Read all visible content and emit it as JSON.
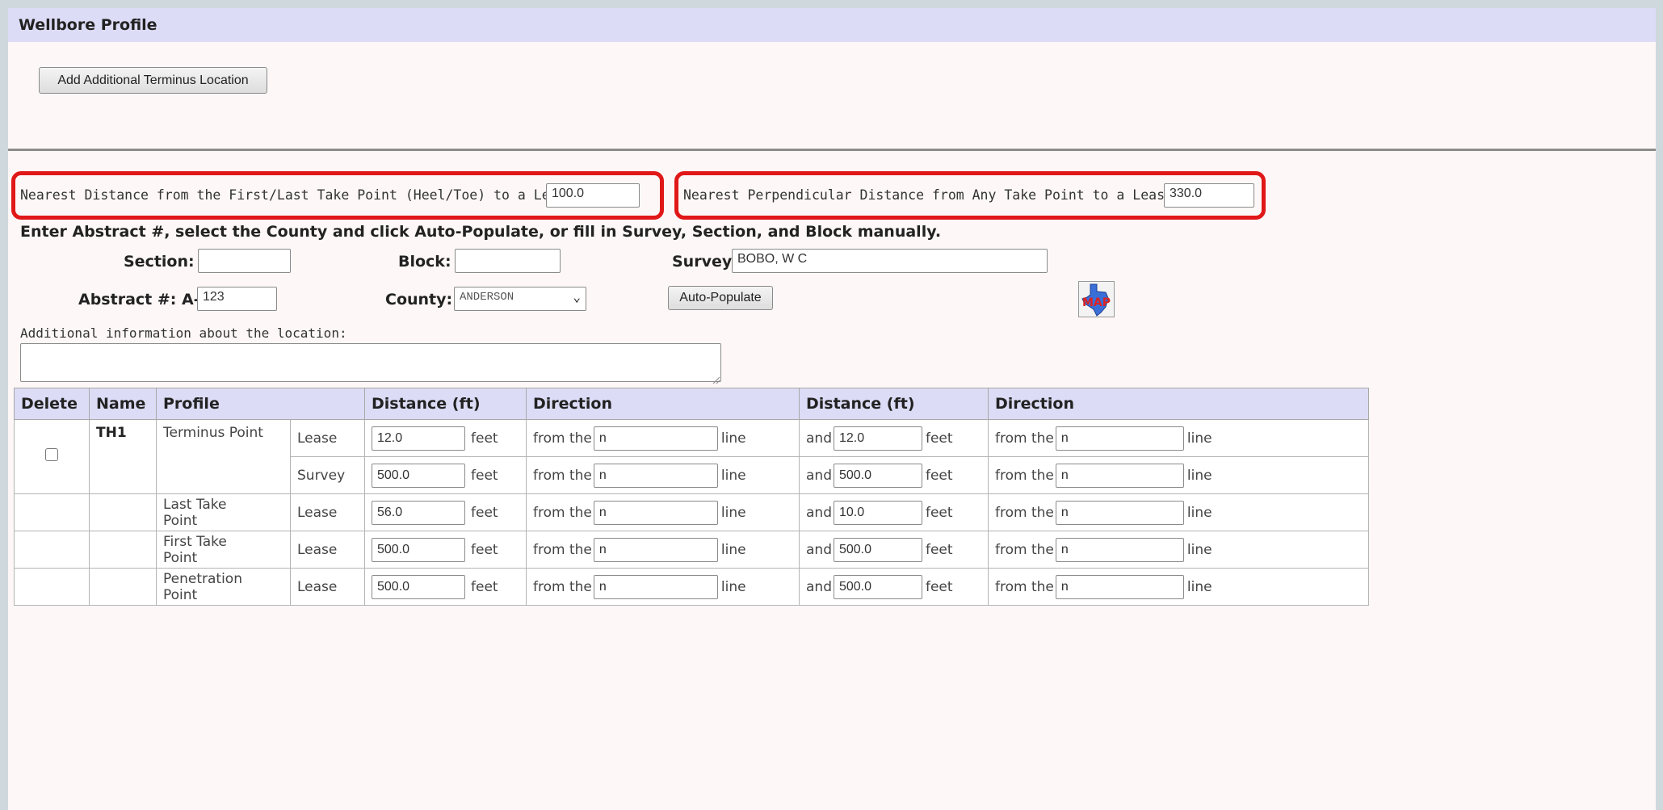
{
  "section_title": "Wellbore Profile",
  "add_terminus_button": "Add Additional Terminus Location",
  "nearest_first_last": {
    "label": "Nearest Distance from the First/Last Take Point (Heel/Toe) to a Lease Line:",
    "value": "100.0"
  },
  "nearest_perpendicular": {
    "label": "Nearest Perpendicular Distance from Any Take Point to a Lease Line:",
    "value": "330.0"
  },
  "instructions": "Enter Abstract #, select the County and click Auto-Populate, or fill in Survey, Section, and Block manually.",
  "section_field": {
    "label": "Section:",
    "value": ""
  },
  "block_field": {
    "label": "Block:",
    "value": ""
  },
  "survey_field": {
    "label": "Survey:",
    "value": "BOBO, W C"
  },
  "abstract_field": {
    "label": "Abstract #: A-",
    "value": "123"
  },
  "county_field": {
    "label": "County:",
    "value": "ANDERSON"
  },
  "auto_populate_button": "Auto-Populate",
  "map_icon": "MAP",
  "additional_info": {
    "label": "Additional information about the location:",
    "value": ""
  },
  "table": {
    "headers": [
      "Delete",
      "Name",
      "Profile",
      "Distance (ft)",
      "Direction",
      "Distance (ft)",
      "Direction"
    ],
    "feet": "feet",
    "from_the": "from the",
    "line": "line",
    "and": "and",
    "rows": [
      {
        "name": "TH1",
        "profile": "Terminus Point",
        "type": "Lease",
        "dist1": "12.0",
        "dir1": "n",
        "dist2": "12.0",
        "dir2": "n"
      },
      {
        "name": "",
        "profile": "",
        "type": "Survey",
        "dist1": "500.0",
        "dir1": "n",
        "dist2": "500.0",
        "dir2": "n"
      },
      {
        "name": "",
        "profile": "Last Take Point",
        "type": "Lease",
        "dist1": "56.0",
        "dir1": "n",
        "dist2": "10.0",
        "dir2": "n"
      },
      {
        "name": "",
        "profile": "First Take Point",
        "type": "Lease",
        "dist1": "500.0",
        "dir1": "n",
        "dist2": "500.0",
        "dir2": "n"
      },
      {
        "name": "",
        "profile": "Penetration Point",
        "type": "Lease",
        "dist1": "500.0",
        "dir1": "n",
        "dist2": "500.0",
        "dir2": "n"
      }
    ]
  },
  "colors": {
    "header_bg": "#dcdcf6",
    "highlight": "#e01818",
    "panel_bg": "#fdf7f7"
  }
}
